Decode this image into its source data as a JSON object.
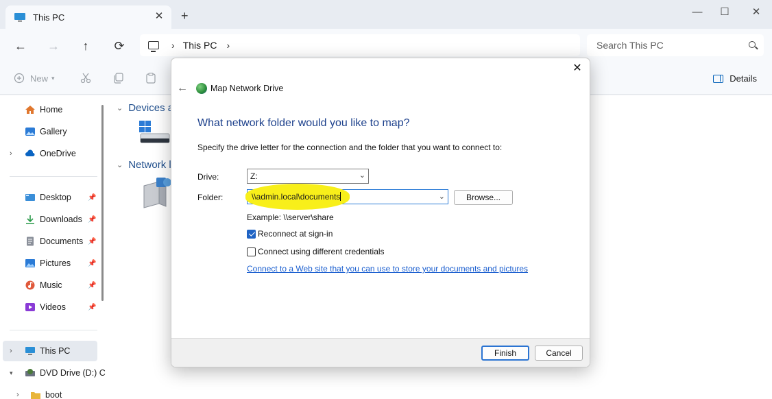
{
  "window": {
    "tab_title": "This PC",
    "tab_close": "✕",
    "new_tab": "+",
    "minimize": "—",
    "maximize": "☐",
    "close": "✕"
  },
  "nav": {
    "back": "←",
    "forward": "→",
    "up": "↑",
    "refresh": "⟳",
    "breadcrumb_sep": "›",
    "breadcrumb": "This PC",
    "breadcrumb_more": "›",
    "search_placeholder": "Search This PC"
  },
  "toolbar": {
    "new_label": "New",
    "details_label": "Details"
  },
  "sidebar": {
    "items": [
      {
        "label": "Home",
        "icon": "home-icon",
        "color": "#e0772e"
      },
      {
        "label": "Gallery",
        "icon": "gallery-icon",
        "color": "#2b7bd6"
      },
      {
        "label": "OneDrive",
        "icon": "cloud-icon",
        "color": "#0a64c2"
      },
      {
        "label": "Desktop",
        "icon": "desktop-icon",
        "color": "#3a8ed8"
      },
      {
        "label": "Downloads",
        "icon": "download-icon",
        "color": "#2a9a4a"
      },
      {
        "label": "Documents",
        "icon": "document-icon",
        "color": "#8a8f99"
      },
      {
        "label": "Pictures",
        "icon": "pictures-icon",
        "color": "#2b7bd6"
      },
      {
        "label": "Music",
        "icon": "music-icon",
        "color": "#e0593b"
      },
      {
        "label": "Videos",
        "icon": "video-icon",
        "color": "#8a3bd6"
      },
      {
        "label": "This PC",
        "icon": "pc-icon",
        "color": "#2a8fd6"
      },
      {
        "label": "DVD Drive (D:) C",
        "icon": "dvd-icon",
        "color": "#4a7a3a"
      },
      {
        "label": "boot",
        "icon": "folder-icon",
        "color": "#e8b53a"
      }
    ]
  },
  "content": {
    "group_devices": "Devices a",
    "group_network": "Network l"
  },
  "dialog": {
    "title": "Map Network Drive",
    "close": "✕",
    "back": "←",
    "heading": "What network folder would you like to map?",
    "description": "Specify the drive letter for the connection and the folder that you want to connect to:",
    "drive_label": "Drive:",
    "drive_value": "Z:",
    "folder_label": "Folder:",
    "folder_value": "\\\\admin.local\\documents",
    "browse_label": "Browse...",
    "example": "Example: \\\\server\\share",
    "reconnect_label": "Reconnect at sign-in",
    "reconnect_checked": true,
    "credentials_label": "Connect using different credentials",
    "credentials_checked": false,
    "link_text": "Connect to a Web site that you can use to store your documents and pictures",
    "link_suffix": ".",
    "finish_label": "Finish",
    "cancel_label": "Cancel",
    "highlight_color": "#f8ef1a"
  }
}
